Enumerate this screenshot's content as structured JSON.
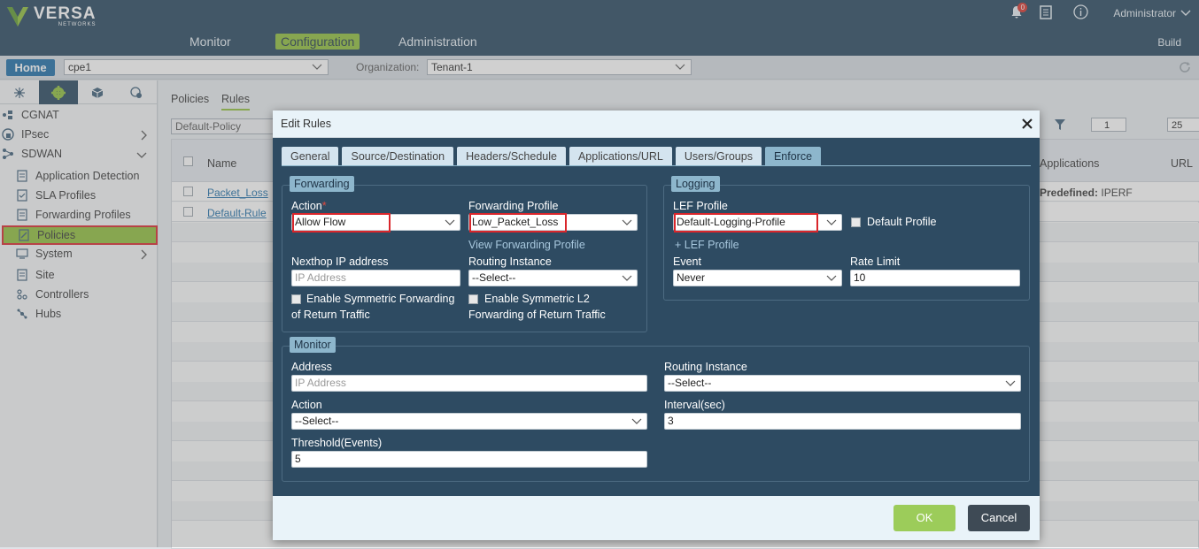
{
  "brand": {
    "name": "VERSA",
    "sub": "NETWORKS"
  },
  "topnav": {
    "monitor": "Monitor",
    "configuration": "Configuration",
    "administration": "Administration",
    "build": "Build"
  },
  "header": {
    "notification_count": "0",
    "user": "Administrator"
  },
  "appbar": {
    "home": "Home",
    "device": "cpe1",
    "org_label": "Organization:",
    "org": "Tenant-1"
  },
  "sidebar": {
    "items": [
      {
        "label": "CGNAT"
      },
      {
        "label": "IPsec"
      },
      {
        "label": "SDWAN"
      },
      {
        "label": "Application Detection"
      },
      {
        "label": "SLA Profiles"
      },
      {
        "label": "Forwarding Profiles"
      },
      {
        "label": "Policies"
      },
      {
        "label": "System"
      },
      {
        "label": "Site"
      },
      {
        "label": "Controllers"
      },
      {
        "label": "Hubs"
      }
    ]
  },
  "content": {
    "tabs": [
      "Policies",
      "Rules"
    ],
    "policy_select": "Default-Policy",
    "columns": {
      "name": "Name",
      "applications": "Applications",
      "url": "URL"
    },
    "rows": [
      {
        "name": "Packet_Loss",
        "app_prefix": "Predefined:",
        "app_value": "IPERF"
      },
      {
        "name": "Default-Rule"
      }
    ],
    "page": "1",
    "page_size": "25"
  },
  "modal": {
    "title": "Edit Rules",
    "tabs": [
      "General",
      "Source/Destination",
      "Headers/Schedule",
      "Applications/URL",
      "Users/Groups",
      "Enforce"
    ],
    "active_tab": "Enforce",
    "forwarding": {
      "legend": "Forwarding",
      "action_label": "Action",
      "action_required": "*",
      "action_value": "Allow Flow",
      "fwd_profile_label": "Forwarding Profile",
      "fwd_profile_value": "Low_Packet_Loss",
      "view_fwd_profile": "View Forwarding Profile",
      "nexthop_label": "Nexthop IP address",
      "nexthop_placeholder": "IP Address",
      "routing_instance_label": "Routing Instance",
      "routing_instance_value": "--Select--",
      "sym_fwd_label_1": "Enable Symmetric Forwarding",
      "sym_fwd_label_2": "of Return Traffic",
      "sym_l2_label_1": "Enable Symmetric L2",
      "sym_l2_label_2": "Forwarding of Return Traffic"
    },
    "logging": {
      "legend": "Logging",
      "lef_profile_label": "LEF Profile",
      "lef_profile_value": "Default-Logging-Profile",
      "default_profile_label": "Default Profile",
      "add_lef_profile": "+ LEF Profile",
      "event_label": "Event",
      "event_value": "Never",
      "rate_limit_label": "Rate Limit",
      "rate_limit_value": "10"
    },
    "monitor": {
      "legend": "Monitor",
      "address_label": "Address",
      "address_placeholder": "IP Address",
      "routing_instance_label": "Routing Instance",
      "routing_instance_value": "--Select--",
      "action_label": "Action",
      "action_value": "--Select--",
      "interval_label": "Interval(sec)",
      "interval_value": "3",
      "threshold_label": "Threshold(Events)",
      "threshold_value": "5"
    },
    "ok": "OK",
    "cancel": "Cancel"
  }
}
